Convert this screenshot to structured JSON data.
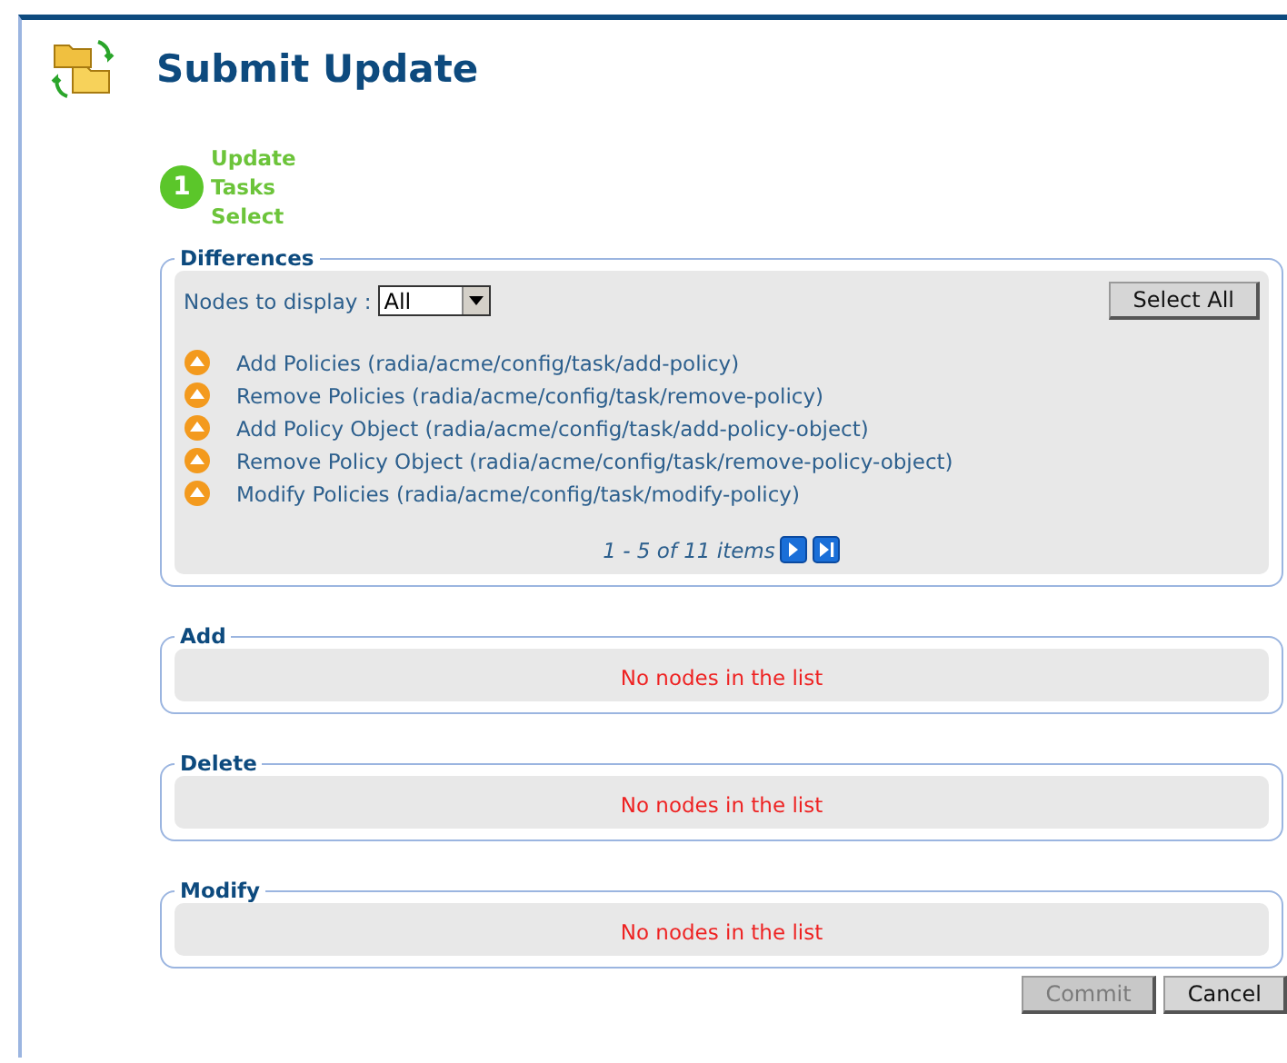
{
  "title": "Submit Update",
  "step": {
    "number": "1",
    "lines": [
      "Update",
      "Tasks",
      "Select"
    ]
  },
  "differences": {
    "legend": "Differences",
    "filter_label": "Nodes to display :",
    "filter_value": "All",
    "select_all": "Select All",
    "items": [
      {
        "label": "Add Policies (radia/acme/config/task/add-policy)"
      },
      {
        "label": "Remove Policies (radia/acme/config/task/remove-policy)"
      },
      {
        "label": "Add Policy Object (radia/acme/config/task/add-policy-object)"
      },
      {
        "label": "Remove Policy Object (radia/acme/config/task/remove-policy-object)"
      },
      {
        "label": "Modify Policies (radia/acme/config/task/modify-policy)"
      }
    ],
    "pager": "1 - 5 of 11 items"
  },
  "sections": [
    {
      "legend": "Add",
      "message": "No nodes in the list"
    },
    {
      "legend": "Delete",
      "message": "No nodes in the list"
    },
    {
      "legend": "Modify",
      "message": "No nodes in the list"
    }
  ],
  "buttons": [
    {
      "label": "Commit",
      "disabled": true
    },
    {
      "label": "Cancel",
      "disabled": false
    }
  ]
}
